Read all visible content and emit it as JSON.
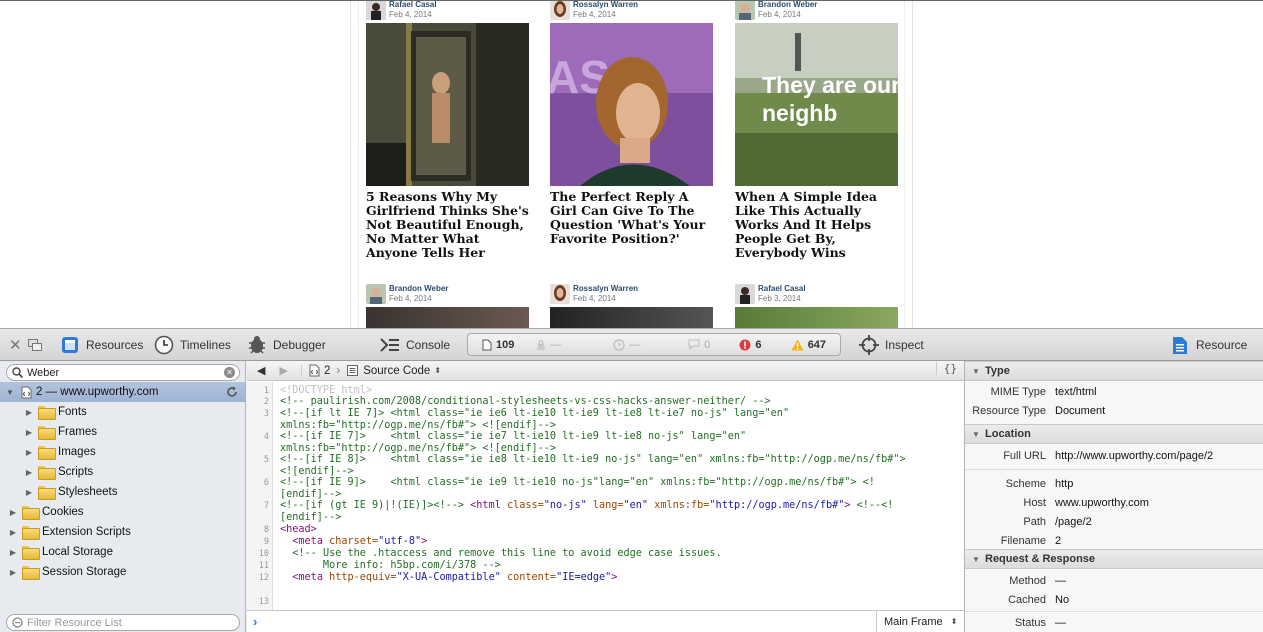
{
  "page": {
    "cards": [
      {
        "author": "Rafael Casal",
        "date": "Feb 4, 2014",
        "title": "5 Reasons Why My Girlfriend Thinks She's Not Beautiful Enough, No Matter What Anyone Tells Her"
      },
      {
        "author": "Rossalyn Warren",
        "date": "Feb 4, 2014",
        "title": "The Perfect Reply A Girl Can Give To The Question 'What's Your Favorite Position?'"
      },
      {
        "author": "Brandon Weber",
        "date": "Feb 4, 2014",
        "title": "When A Simple Idea Like This Actually Works And It Helps People Get By, Everybody Wins",
        "image_text": "They are our neighb"
      },
      {
        "author": "Brandon Weber",
        "date": "Feb 4, 2014"
      },
      {
        "author": "Rossalyn Warren",
        "date": "Feb 4, 2014"
      },
      {
        "author": "Rafael Casal",
        "date": "Feb 3, 2014"
      }
    ]
  },
  "toolbar": {
    "resources": "Resources",
    "timelines": "Timelines",
    "debugger": "Debugger",
    "console": "Console",
    "inspect": "Inspect",
    "resource": "Resource",
    "dashboard": {
      "resources_count": "109",
      "bytes": "—",
      "time": "—",
      "logs": "0",
      "errors": "6",
      "warnings": "647"
    }
  },
  "sidebar": {
    "search_value": "Weber",
    "root": "2 — www.upworthy.com",
    "children": [
      "Fonts",
      "Frames",
      "Images",
      "Scripts",
      "Stylesheets"
    ],
    "groups": [
      "Cookies",
      "Extension Scripts",
      "Local Storage",
      "Session Storage"
    ],
    "filter_placeholder": "Filter Resource List"
  },
  "codebar": {
    "crumb": "2",
    "mode": "Source Code",
    "format": "{}"
  },
  "console_bar": {
    "frame": "Main Frame"
  },
  "code_lines": [
    {
      "n": "1",
      "html": "<span class='dt'>&lt;!DOCTYPE html&gt;</span>"
    },
    {
      "n": "2",
      "html": "<span class='cm'>&lt;!-- paulirish.com/2008/conditional-stylesheets-vs-css-hacks-answer-neither/ --&gt;</span>"
    },
    {
      "n": "3",
      "html": "<span class='cm'>&lt;!--[if lt IE 7]&gt; &lt;html class=\"ie ie6 lt-ie10 lt-ie9 lt-ie8 lt-ie7 no-js\" lang=\"en\"\nxmlns:fb=\"http://ogp.me/ns/fb#\"&gt; &lt;![endif]--&gt;</span>"
    },
    {
      "n": "4",
      "html": "<span class='cm'>&lt;!--[if IE 7]&gt;    &lt;html class=\"ie ie7 lt-ie10 lt-ie9 lt-ie8 no-js\" lang=\"en\"\nxmlns:fb=\"http://ogp.me/ns/fb#\"&gt; &lt;![endif]--&gt;</span>"
    },
    {
      "n": "5",
      "html": "<span class='cm'>&lt;!--[if IE 8]&gt;    &lt;html class=\"ie ie8 lt-ie10 lt-ie9 no-js\" lang=\"en\" xmlns:fb=\"http://ogp.me/ns/fb#\"&gt;\n&lt;![endif]--&gt;</span>"
    },
    {
      "n": "6",
      "html": "<span class='cm'>&lt;!--[if IE 9]&gt;    &lt;html class=\"ie ie9 lt-ie10 no-js\"lang=\"en\" xmlns:fb=\"http://ogp.me/ns/fb#\"&gt; &lt;!\n[endif]--&gt;</span>"
    },
    {
      "n": "7",
      "html": "<span class='cm'>&lt;!--[if (gt IE 9)|!(IE)]&gt;&lt;!--&gt;</span> <span class='tg'>&lt;html</span> <span class='at'>class=</span><span class='st'>\"no-js\"</span> <span class='at'>lang=</span><span class='st'>\"en\"</span> <span class='at'>xmlns:fb=</span><span class='st'>\"http://ogp.me/ns/fb#\"</span><span class='tg'>&gt;</span> <span class='cm'>&lt;!--&lt;!\n[endif]--&gt;</span>"
    },
    {
      "n": "8",
      "html": "<span class='tg'>&lt;head&gt;</span>"
    },
    {
      "n": "9",
      "html": "  <span class='tg'>&lt;meta</span> <span class='at'>charset=</span><span class='st'>\"utf-8\"</span><span class='tg'>&gt;</span>"
    },
    {
      "n": "10",
      "html": "  <span class='cm'>&lt;!-- Use the .htaccess and remove this line to avoid edge case issues.</span>"
    },
    {
      "n": "11",
      "html": "<span class='cm'>       More info: h5bp.com/i/378 --&gt;</span>"
    },
    {
      "n": "12",
      "html": "  <span class='tg'>&lt;meta</span> <span class='at'>http-equiv=</span><span class='st'>\"X-UA-Compatible\"</span> <span class='at'>content=</span><span class='st'>\"IE=edge\"</span><span class='tg'>&gt;</span>"
    },
    {
      "n": "13",
      "html": ""
    }
  ],
  "details": {
    "type_title": "Type",
    "type": [
      {
        "k": "MIME Type",
        "v": "text/html"
      },
      {
        "k": "Resource Type",
        "v": "Document"
      }
    ],
    "location_title": "Location",
    "location": [
      {
        "k": "Full URL",
        "v": "http://www.upworthy.com/page/2"
      },
      {
        "k": "Scheme",
        "v": "http"
      },
      {
        "k": "Host",
        "v": "www.upworthy.com"
      },
      {
        "k": "Path",
        "v": "/page/2"
      },
      {
        "k": "Filename",
        "v": "2"
      }
    ],
    "rr_title": "Request & Response",
    "rr": [
      {
        "k": "Method",
        "v": "—"
      },
      {
        "k": "Cached",
        "v": "No"
      },
      {
        "k": "Status",
        "v": "—"
      }
    ]
  }
}
